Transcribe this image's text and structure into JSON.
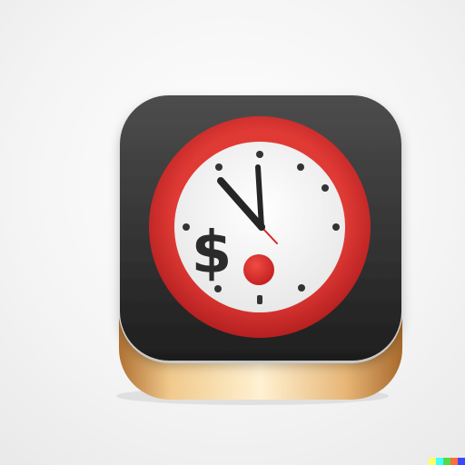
{
  "app_icon": {
    "subject": "clock-with-dollar-sign",
    "clock": {
      "hour_hand_points_to": 11,
      "minute_hand_points_to": 12,
      "second_hand_points_to": 5
    },
    "currency_symbol": "$",
    "colors": {
      "background": "#f3f3f3",
      "tile_top": "#4a4a4a",
      "tile_bottom": "#1f1f1f",
      "base_gold_light": "#f3d29a",
      "base_gold_dark": "#a96a2c",
      "clock_ring": "#cf2b2b",
      "clock_face": "#ffffff",
      "clock_hands": "#2a2a2a",
      "second_hand": "#d62828"
    }
  },
  "watermark": {
    "colors": [
      "#ffff66",
      "#42ffff",
      "#51da4c",
      "#ff6e3c",
      "#3c46ff"
    ]
  }
}
